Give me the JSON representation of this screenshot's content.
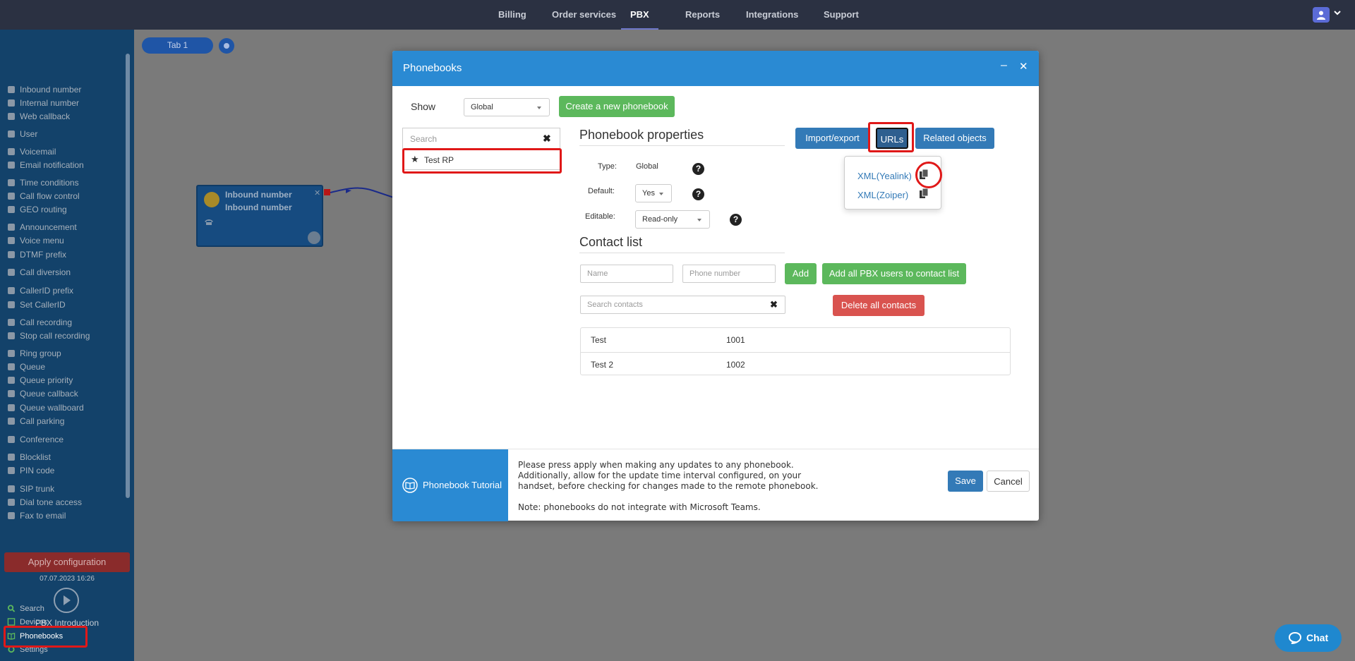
{
  "topnav": {
    "items": [
      {
        "label": "Billing"
      },
      {
        "label": "Order services"
      },
      {
        "label": "PBX"
      },
      {
        "label": "Reports"
      },
      {
        "label": "Integrations"
      },
      {
        "label": "Support"
      }
    ],
    "active": "PBX"
  },
  "sidebar": {
    "items": [
      {
        "label": "Inbound number",
        "icon": "arrow-circle-icon"
      },
      {
        "label": "Internal number",
        "icon": "map-pin-icon"
      },
      {
        "label": "Web callback",
        "icon": "undo-icon"
      },
      {
        "label": "User",
        "icon": "user-icon"
      },
      {
        "label": "Voicemail",
        "icon": "envelope-icon"
      },
      {
        "label": "Email notification",
        "icon": "bell-icon"
      },
      {
        "label": "Time conditions",
        "icon": "clock-icon"
      },
      {
        "label": "Call flow control",
        "icon": "toggle-icon"
      },
      {
        "label": "GEO routing",
        "icon": "sitemap-icon"
      },
      {
        "label": "Announcement",
        "icon": "bullhorn-icon"
      },
      {
        "label": "Voice menu",
        "icon": "grid-icon"
      },
      {
        "label": "DTMF prefix",
        "icon": "code-icon"
      },
      {
        "label": "Call diversion",
        "icon": "refresh-icon"
      },
      {
        "label": "CallerID prefix",
        "icon": "list-icon"
      },
      {
        "label": "Set CallerID",
        "icon": "list-icon"
      },
      {
        "label": "Call recording",
        "icon": "microphone-icon"
      },
      {
        "label": "Stop call recording",
        "icon": "microphone-slash-icon"
      },
      {
        "label": "Ring group",
        "icon": "users-icon"
      },
      {
        "label": "Queue",
        "icon": "user-plus-icon"
      },
      {
        "label": "Queue priority",
        "icon": "arrow-up-icon"
      },
      {
        "label": "Queue callback",
        "icon": "share-icon"
      },
      {
        "label": "Queue wallboard",
        "icon": "table-icon"
      },
      {
        "label": "Call parking",
        "icon": "parking-icon"
      },
      {
        "label": "Conference",
        "icon": "comments-icon"
      },
      {
        "label": "Blocklist",
        "icon": "ban-icon"
      },
      {
        "label": "PIN code",
        "icon": "key-icon"
      },
      {
        "label": "SIP trunk",
        "icon": "sitemap-icon"
      },
      {
        "label": "Dial tone access",
        "icon": "lock-icon"
      },
      {
        "label": "Fax to email",
        "icon": "fax-icon"
      }
    ],
    "apply_label": "Apply configuration",
    "apply_date": "07.07.2023 16:26",
    "intro_label": "PBX Introduction",
    "bottom_items": [
      {
        "label": "Search",
        "icon": "search-icon"
      },
      {
        "label": "Devices",
        "icon": "device-icon"
      },
      {
        "label": "Phonebooks",
        "icon": "book-icon"
      },
      {
        "label": "Settings",
        "icon": "gear-icon"
      }
    ]
  },
  "canvas": {
    "tab_label": "Tab 1",
    "node": {
      "title": "Inbound number",
      "subtitle": "Inbound number"
    }
  },
  "modal": {
    "title": "Phonebooks",
    "show_label": "Show",
    "show_value": "Global",
    "create_label": "Create a new phonebook",
    "search_placeholder": "Search",
    "phonebooks": [
      {
        "name": "Test RP"
      }
    ],
    "properties_title": "Phonebook properties",
    "type_label": "Type:",
    "type_value": "Global",
    "default_label": "Default:",
    "default_value": "Yes",
    "editable_label": "Editable:",
    "editable_value": "Read-only",
    "import_export_label": "Import/export",
    "urls_label": "URLs",
    "related_label": "Related objects",
    "url_items": [
      {
        "label": "XML(Yealink)"
      },
      {
        "label": "XML(Zoiper)"
      }
    ],
    "contact_list_title": "Contact list",
    "name_placeholder": "Name",
    "phone_placeholder": "Phone number",
    "add_label": "Add",
    "add_all_label": "Add all PBX users to contact list",
    "search_contacts_placeholder": "Search contacts",
    "delete_all_label": "Delete all contacts",
    "contacts": [
      {
        "name": "Test",
        "number": "1001"
      },
      {
        "name": "Test 2",
        "number": "1002"
      }
    ],
    "tutorial_label": "Phonebook Tutorial",
    "note_lines": [
      "Please press apply when making any updates to any phonebook.",
      "Additionally, allow for the update time interval configured, on your",
      "handset, before checking for changes made to the remote phonebook."
    ],
    "note_teams": "Note: phonebooks do not integrate with Microsoft Teams.",
    "save_label": "Save",
    "cancel_label": "Cancel"
  },
  "chat": {
    "label": "Chat"
  },
  "colors": {
    "topnav_bg": "#2b3142",
    "sidebar_bg": "#13426a",
    "modal_header": "#2a8ad3",
    "primary": "#337ab7",
    "success": "#5cb85c",
    "danger": "#d9534f",
    "highlight": "#e01818"
  }
}
